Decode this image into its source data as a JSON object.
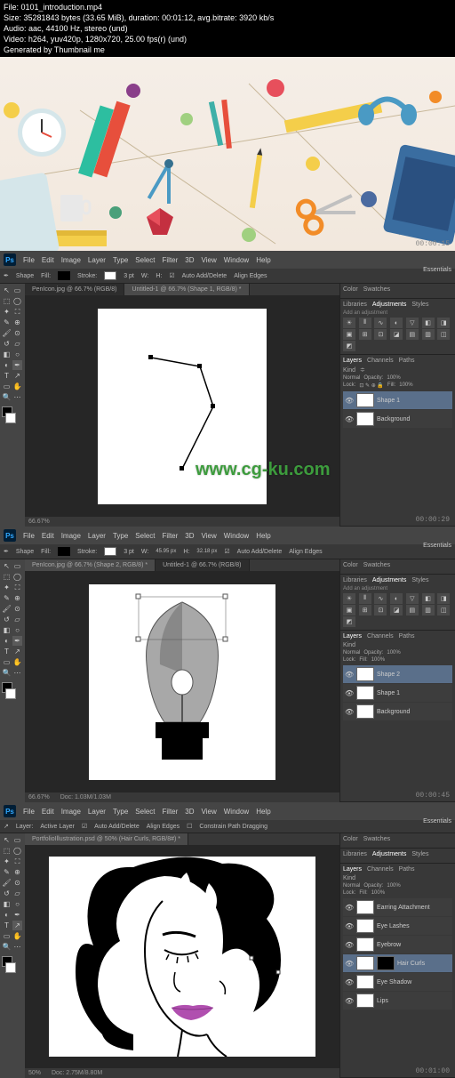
{
  "header": {
    "file": "File: 0101_introduction.mp4",
    "size": "Size: 35281843 bytes (33.65 MiB), duration: 00:01:12, avg.bitrate: 3920 kb/s",
    "audio": "Audio: aac, 44100 Hz, stereo (und)",
    "video": "Video: h264, yuv420p, 1280x720, 25.00 fps(r) (und)",
    "gen": "Generated by Thumbnail me"
  },
  "banner_time": "00:00:15",
  "watermark": "www.cg-ku.com",
  "menu": [
    "File",
    "Edit",
    "Image",
    "Layer",
    "Type",
    "Select",
    "Filter",
    "3D",
    "View",
    "Window",
    "Help"
  ],
  "essentials": "Essentials",
  "options1": {
    "shape": "Shape",
    "fill": "Fill:",
    "stroke": "Stroke:",
    "stroke_pt": "3 pt",
    "w": "W:",
    "h": "H:",
    "auto": "Auto Add/Delete",
    "align": "Align Edges"
  },
  "options3": {
    "layer": "Layer:",
    "active": "Active Layer",
    "auto": "Auto Add/Delete",
    "align": "Align Edges",
    "constrain": "Constrain Path Dragging"
  },
  "panel1": {
    "tab1": "PenIcon.jpg @ 66.7% (RGB/8)",
    "tab2": "Untitled-1 @ 66.7% (Shape 1, RGB/8) *",
    "zoom": "66.67%",
    "time": "00:00:29"
  },
  "panel2": {
    "tab1": "PenIcon.jpg @ 66.7% (Shape 2, RGB/8) *",
    "tab2": "Untitled-1 @ 66.7% (RGB/8)",
    "zoom": "66.67%",
    "doc": "Doc: 1.03M/1.03M",
    "time": "00:00:45"
  },
  "panel3": {
    "tab1": "PortfolioIllustration.psd @ 50% (Hair Curls, RGB/8#) *",
    "zoom": "50%",
    "doc": "Doc: 2.75M/8.80M",
    "time": "00:01:00"
  },
  "adjust": {
    "tabs": [
      "Color",
      "Swatches"
    ],
    "tabs2": [
      "Libraries",
      "Adjustments",
      "Styles"
    ],
    "label": "Add an adjustment"
  },
  "layers": {
    "tabs": [
      "Layers",
      "Channels",
      "Paths"
    ],
    "kind": "Kind",
    "normal": "Normal",
    "opacity": "Opacity:",
    "opacity_val": "100%",
    "lock": "Lock:",
    "fill": "Fill:",
    "fill_val": "100%"
  },
  "layers1": [
    {
      "name": "Shape 1",
      "selected": true
    },
    {
      "name": "Background",
      "selected": false
    }
  ],
  "layers2": [
    {
      "name": "Shape 2",
      "selected": true
    },
    {
      "name": "Shape 1",
      "selected": false
    },
    {
      "name": "Background",
      "selected": false
    }
  ],
  "layers3": [
    {
      "name": "Earring Attachment",
      "selected": false
    },
    {
      "name": "Eye Lashes",
      "selected": false
    },
    {
      "name": "Eyebrow",
      "selected": false
    },
    {
      "name": "Hair Curls",
      "selected": true
    },
    {
      "name": "Eye Shadow",
      "selected": false
    },
    {
      "name": "Lips",
      "selected": false
    }
  ]
}
